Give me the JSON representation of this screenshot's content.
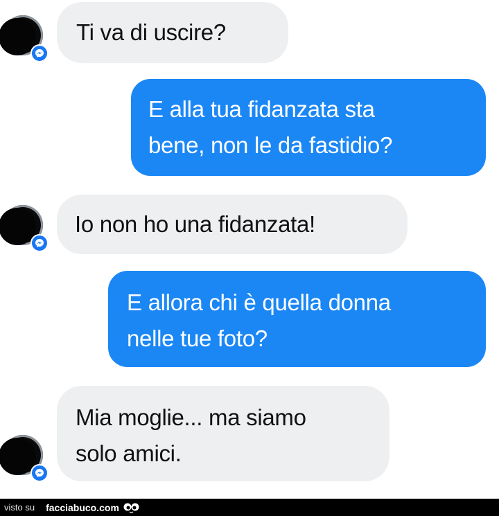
{
  "messages": [
    {
      "sender": "other",
      "text": "Ti va di uscire?"
    },
    {
      "sender": "me",
      "line1": "E alla tua fidanzata sta",
      "line2": "bene, non le da fastidio?"
    },
    {
      "sender": "other",
      "text": "Io non ho una fidanzata!"
    },
    {
      "sender": "me",
      "line1": "E allora chi è quella donna",
      "line2": "nelle tue foto?"
    },
    {
      "sender": "other",
      "line1": "Mia moglie... ma siamo",
      "line2": "solo amici."
    }
  ],
  "colors": {
    "outgoing_bubble": "#1b87f5",
    "incoming_bubble": "#eeeff1",
    "messenger_badge": "#1877f2",
    "footer_bg": "#000000"
  },
  "footer": {
    "prefix": "visto su",
    "site": "facciabuco.com",
    "logo_icon": "googly-eyes-icon"
  }
}
